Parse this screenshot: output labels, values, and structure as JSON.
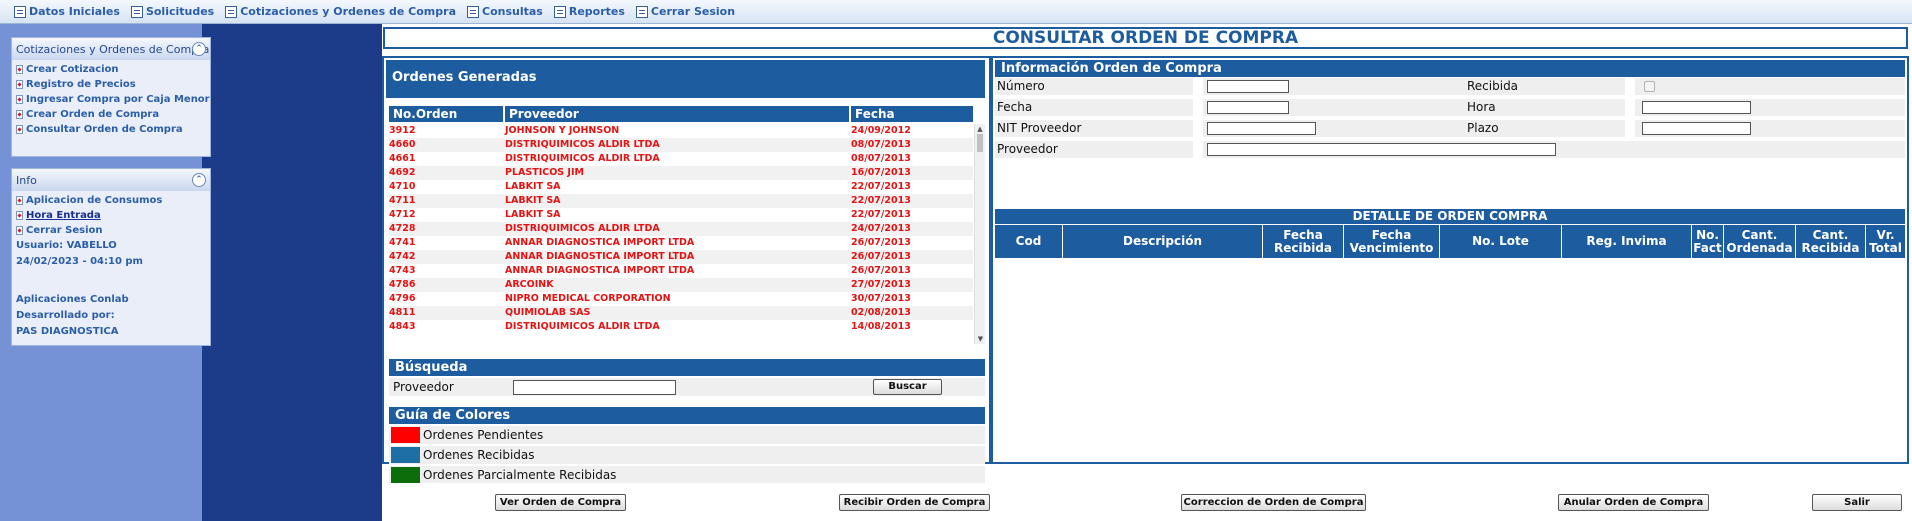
{
  "menu": [
    {
      "label": "Datos Iniciales",
      "icon": "document-icon"
    },
    {
      "label": "Solicitudes",
      "icon": "list-icon"
    },
    {
      "label": "Cotizaciones y Ordenes de Compra",
      "icon": "edit-icon"
    },
    {
      "label": "Consultas",
      "icon": "search-icon"
    },
    {
      "label": "Reportes",
      "icon": "report-icon"
    },
    {
      "label": "Cerrar Sesion",
      "icon": "exit-icon"
    }
  ],
  "sidebar": {
    "cot_title": "Cotizaciones y Ordenes de Compra",
    "cot_items": [
      "Crear Cotizacion",
      "Registro de Precios",
      "Ingresar Compra por Caja Menor",
      "Crear Orden de Compra",
      "Consultar Orden de Compra"
    ],
    "info_title": "Info",
    "info_items": [
      "Aplicacion de Consumos",
      "Hora Entrada",
      "Cerrar Sesion"
    ],
    "usuario": "Usuario: VABELLO",
    "fecha_hora": "24/02/2023 - 04:10 pm",
    "app_name": "Aplicaciones Conlab",
    "dev_by": "Desarrollado por:",
    "dev_name": "PAS DIAGNOSTICA"
  },
  "page_title": "CONSULTAR ORDEN DE COMPRA",
  "ordenes": {
    "title": "Ordenes Generadas",
    "columns": [
      "No.Orden",
      "Proveedor",
      "Fecha"
    ],
    "rows": [
      [
        "3912",
        "JOHNSON Y JOHNSON",
        "24/09/2012"
      ],
      [
        "4660",
        "DISTRIQUIMICOS ALDIR LTDA",
        "08/07/2013"
      ],
      [
        "4661",
        "DISTRIQUIMICOS ALDIR LTDA",
        "08/07/2013"
      ],
      [
        "4692",
        "PLASTICOS JIM",
        "16/07/2013"
      ],
      [
        "4710",
        "LABKIT SA",
        "22/07/2013"
      ],
      [
        "4711",
        "LABKIT SA",
        "22/07/2013"
      ],
      [
        "4712",
        "LABKIT SA",
        "22/07/2013"
      ],
      [
        "4728",
        "DISTRIQUIMICOS ALDIR LTDA",
        "24/07/2013"
      ],
      [
        "4741",
        "ANNAR DIAGNOSTICA IMPORT LTDA",
        "26/07/2013"
      ],
      [
        "4742",
        "ANNAR DIAGNOSTICA IMPORT LTDA",
        "26/07/2013"
      ],
      [
        "4743",
        "ANNAR DIAGNOSTICA IMPORT LTDA",
        "26/07/2013"
      ],
      [
        "4786",
        "ARCOINK",
        "27/07/2013"
      ],
      [
        "4796",
        "NIPRO MEDICAL CORPORATION",
        "30/07/2013"
      ],
      [
        "4811",
        "QUIMIOLAB SAS",
        "02/08/2013"
      ],
      [
        "4843",
        "DISTRIQUIMICOS ALDIR LTDA",
        "14/08/2013"
      ]
    ]
  },
  "busqueda": {
    "title": "Búsqueda",
    "label": "Proveedor",
    "value": "",
    "button": "Buscar"
  },
  "guia": {
    "title": "Guía de Colores",
    "items": [
      {
        "label": "Ordenes Pendientes",
        "color": "#ff0000"
      },
      {
        "label": "Ordenes Recibidas",
        "color": "#1d6fa5"
      },
      {
        "label": "Ordenes Parcialmente Recibidas",
        "color": "#0b6e0b"
      }
    ]
  },
  "info": {
    "title": "Información Orden de Compra",
    "numero": "Número",
    "recibida": "Recibida",
    "fecha": "Fecha",
    "hora": "Hora",
    "nit": "NIT Proveedor",
    "plazo": "Plazo",
    "proveedor": "Proveedor"
  },
  "detalle": {
    "title": "DETALLE DE ORDEN COMPRA",
    "columns": [
      "Cod",
      "Descripción",
      "Fecha Recibida",
      "Fecha Vencimiento",
      "No. Lote",
      "Reg. Invima",
      "No. Fact",
      "Cant. Ordenada",
      "Cant. Recibida",
      "Vr. Total"
    ]
  },
  "actions": [
    "Ver Orden de Compra",
    "Recibir Orden de Compra",
    "Correccion de Orden de Compra",
    "Anular Orden de Compra",
    "Salir"
  ]
}
